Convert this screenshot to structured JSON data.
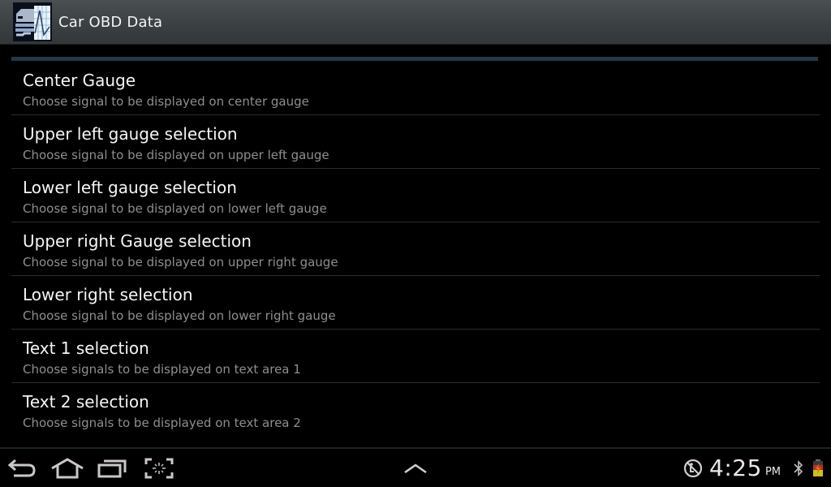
{
  "app": {
    "title": "Car OBD Data",
    "icon": "car-obd-app-icon"
  },
  "preferences": [
    {
      "title": "Center Gauge",
      "summary": "Choose signal to be displayed on center gauge"
    },
    {
      "title": "Upper left gauge selection",
      "summary": "Choose signal to be displayed on upper left gauge"
    },
    {
      "title": "Lower left gauge selection",
      "summary": "Choose signal to be displayed on lower left gauge"
    },
    {
      "title": "Upper right Gauge selection",
      "summary": "Choose signal to be displayed on upper right gauge"
    },
    {
      "title": "Lower right selection",
      "summary": "Choose signal to be displayed on lower right gauge"
    },
    {
      "title": "Text 1 selection",
      "summary": "Choose signals to be displayed on text area 1"
    },
    {
      "title": "Text 2 selection",
      "summary": "Choose signals to be displayed on text area 2"
    }
  ],
  "navbar": {
    "buttons": [
      "back-icon",
      "home-icon",
      "recent-apps-icon",
      "screenshot-icon"
    ],
    "center": "menu-up-icon"
  },
  "status": {
    "time": "4:25",
    "ampm": "PM",
    "icons": [
      "debug-usb-icon",
      "bluetooth-icon",
      "battery-charging-icon"
    ]
  },
  "colors": {
    "accent_strip": "#1f3a48",
    "title_text": "#f5f5f5",
    "summary_text": "#8e8e8e"
  }
}
